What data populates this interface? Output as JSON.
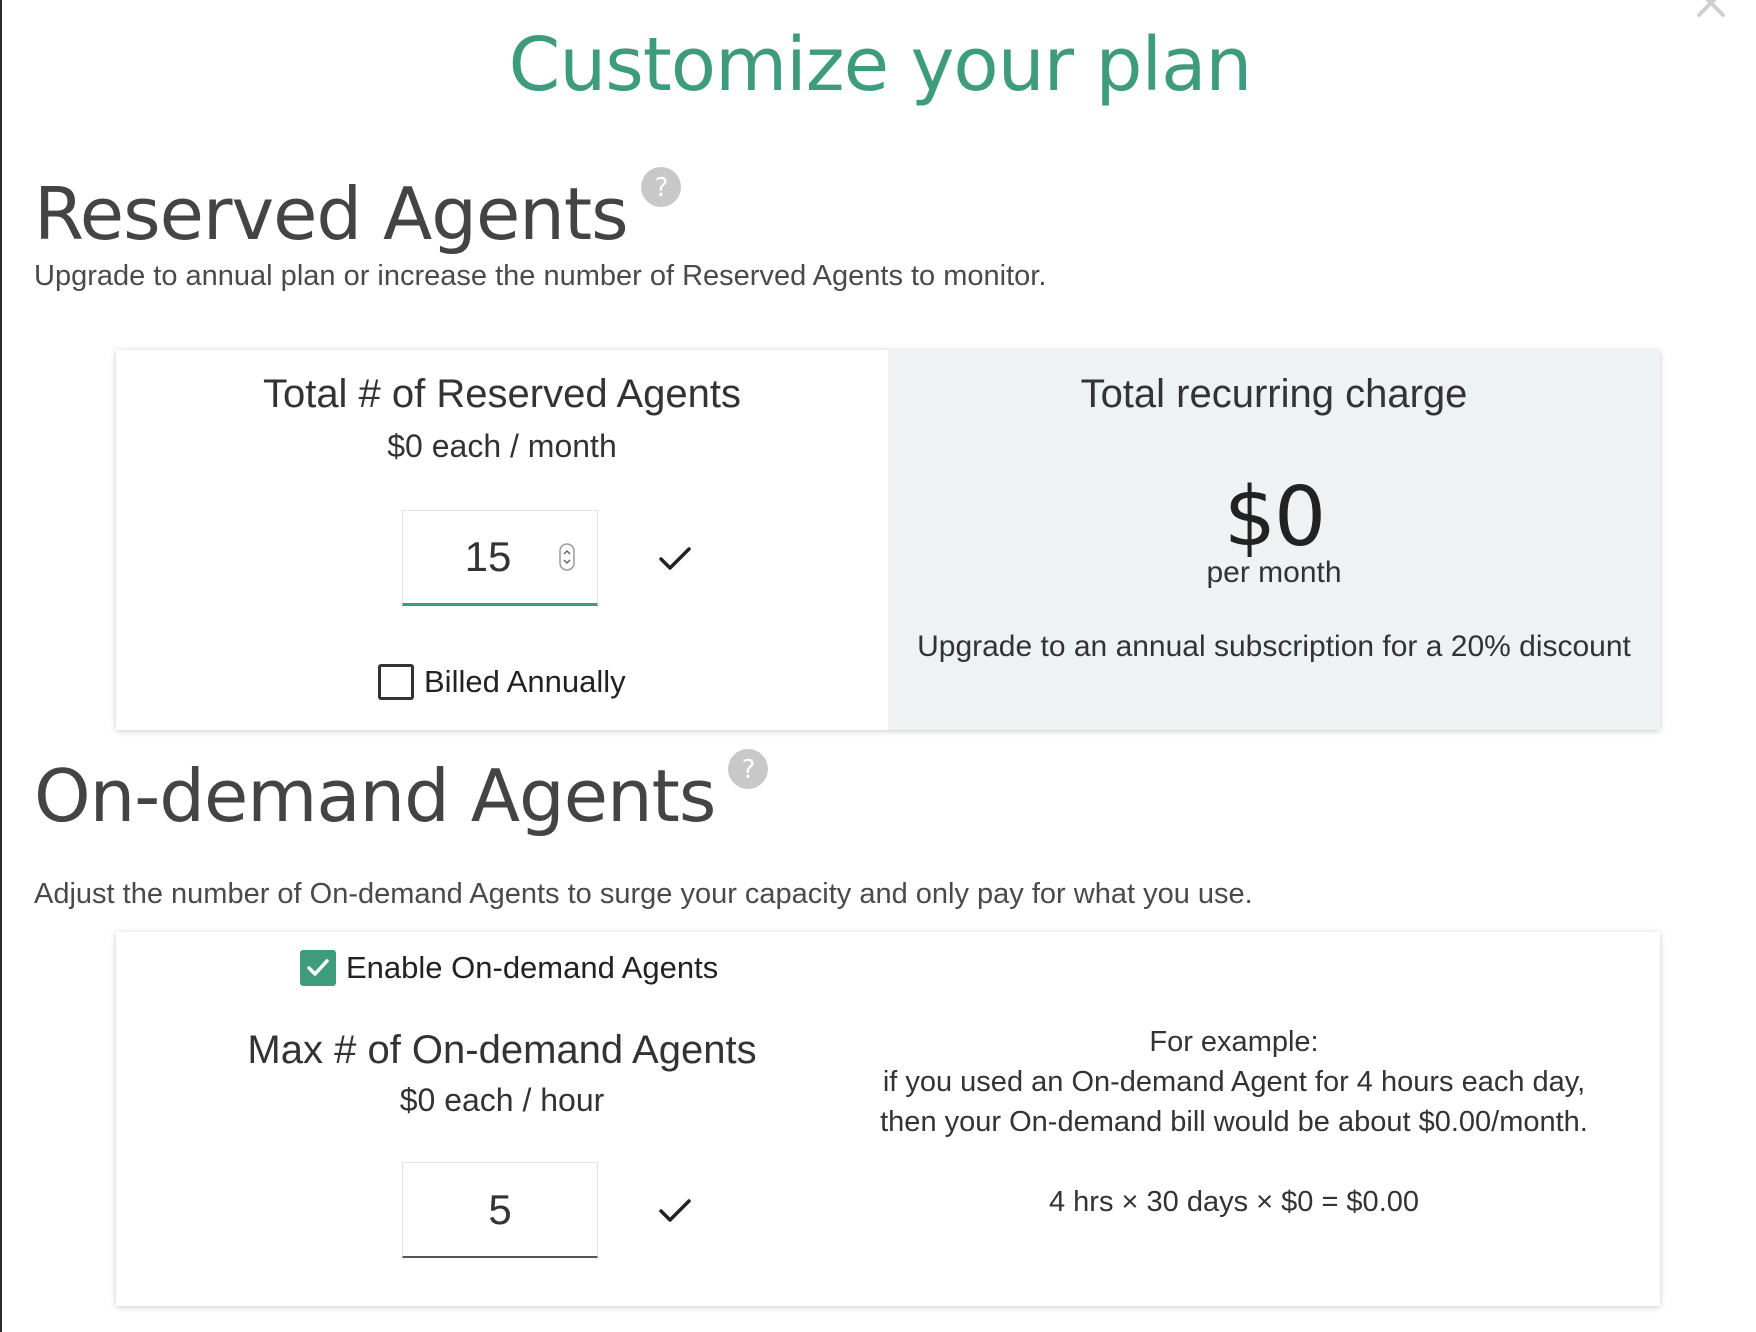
{
  "header": {
    "title": "Customize your plan"
  },
  "reserved": {
    "title": "Reserved Agents",
    "description": "Upgrade to annual plan or increase the number of Reserved Agents to monitor.",
    "input_label": "Total # of Reserved Agents",
    "price_label": "$0 each / month",
    "agent_count": "15",
    "billed_annually_label": "Billed Annually",
    "billed_annually_checked": false,
    "charge_title": "Total recurring charge",
    "charge_amount": "$0",
    "charge_period": "per month",
    "discount_note": "Upgrade to an annual subscription for a 20% discount"
  },
  "on_demand": {
    "title": "On-demand Agents",
    "description": "Adjust the number of On-demand Agents to surge your capacity and only pay for what you use.",
    "enable_label": "Enable On-demand Agents",
    "enable_checked": true,
    "input_label": "Max # of On-demand Agents",
    "price_label": "$0 each / hour",
    "agent_count": "5",
    "example_heading": "For example:",
    "example_line1": "if you used an On-demand Agent for 4 hours each day,",
    "example_line2": "then your On-demand bill would be about $0.00/month.",
    "formula": "4 hrs × 30 days × $0 = $0.00"
  },
  "icons": {
    "close": "close-icon",
    "help": "help-icon",
    "check": "check-icon",
    "spinner": "spinner-icon"
  },
  "colors": {
    "accent": "#3e9c7d",
    "panel_bg": "#eef2f3",
    "help_icon": "#c8c8c8"
  }
}
